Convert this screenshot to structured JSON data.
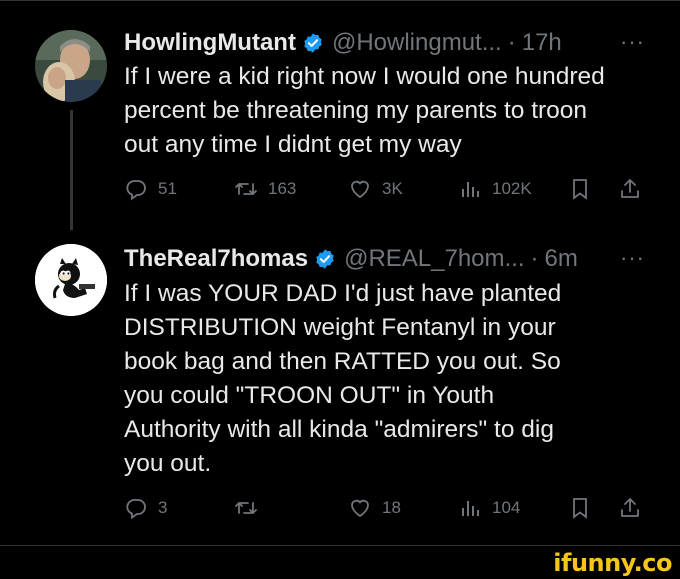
{
  "tweets": [
    {
      "name": "HowlingMutant",
      "handle": "@Howlingmut...",
      "sep": "·",
      "time": "17h",
      "more": "···",
      "text": "If I were a kid right now I would one hundred\npercent be threatening my parents to troon\nout any time I didnt get my way",
      "replies": "51",
      "retweets": "163",
      "likes": "3K",
      "views": "102K"
    },
    {
      "name": "TheReal7homas",
      "handle": "@REAL_7hom...",
      "sep": "·",
      "time": "6m",
      "more": "···",
      "text": "If I was YOUR DAD I'd just have planted\nDISTRIBUTION weight Fentanyl in your\nbook bag and then RATTED you out. So\nyou could \"TROON OUT\" in Youth\nAuthority with all kinda \"admirers\" to dig\nyou out.",
      "replies": "3",
      "retweets": "",
      "likes": "18",
      "views": "104"
    }
  ],
  "watermark": "ifunny.co",
  "colors": {
    "background": "#000000",
    "text": "#e7e9ea",
    "muted": "#71767b",
    "verified": "#1d9bf0",
    "watermark": "#f5c518"
  },
  "icons": [
    "reply-icon",
    "retweet-icon",
    "like-icon",
    "views-icon",
    "bookmark-icon",
    "share-icon",
    "verified-badge-icon"
  ]
}
